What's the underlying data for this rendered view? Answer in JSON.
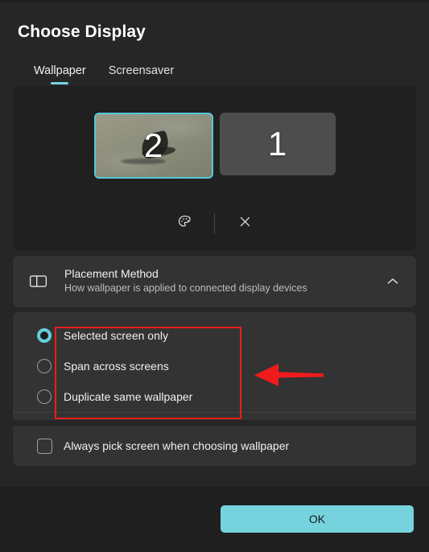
{
  "dialog": {
    "title": "Choose Display",
    "tabs": [
      {
        "label": "Wallpaper",
        "active": true
      },
      {
        "label": "Screensaver",
        "active": false
      }
    ]
  },
  "monitor_picker": {
    "monitors": [
      {
        "number": "2",
        "selected": true,
        "has_wallpaper_preview": true
      },
      {
        "number": "1",
        "selected": false,
        "has_wallpaper_preview": false
      }
    ],
    "actions": [
      {
        "name": "palette-icon",
        "tooltip": "Choose color"
      },
      {
        "name": "close-icon",
        "tooltip": "Close"
      }
    ]
  },
  "placement_section": {
    "icon": "split-panel-icon",
    "title": "Placement Method",
    "subtitle": "How wallpaper is applied to connected display devices",
    "expanded": true,
    "chevron": "chevron-up-icon",
    "options": [
      {
        "label": "Selected screen only",
        "selected": true
      },
      {
        "label": "Span across screens",
        "selected": false
      },
      {
        "label": "Duplicate same wallpaper",
        "selected": false
      }
    ]
  },
  "always_pick": {
    "label": "Always pick screen when choosing wallpaper",
    "checked": false
  },
  "footer": {
    "ok_label": "OK"
  },
  "colors": {
    "accent": "#76d3dd",
    "radio_accent": "#64cfdc",
    "selection_border": "#56c8d8",
    "annotation_red": "#f01b1b",
    "dialog_bg": "#262626",
    "panel_dark": "#202020",
    "panel_light": "#333333"
  }
}
